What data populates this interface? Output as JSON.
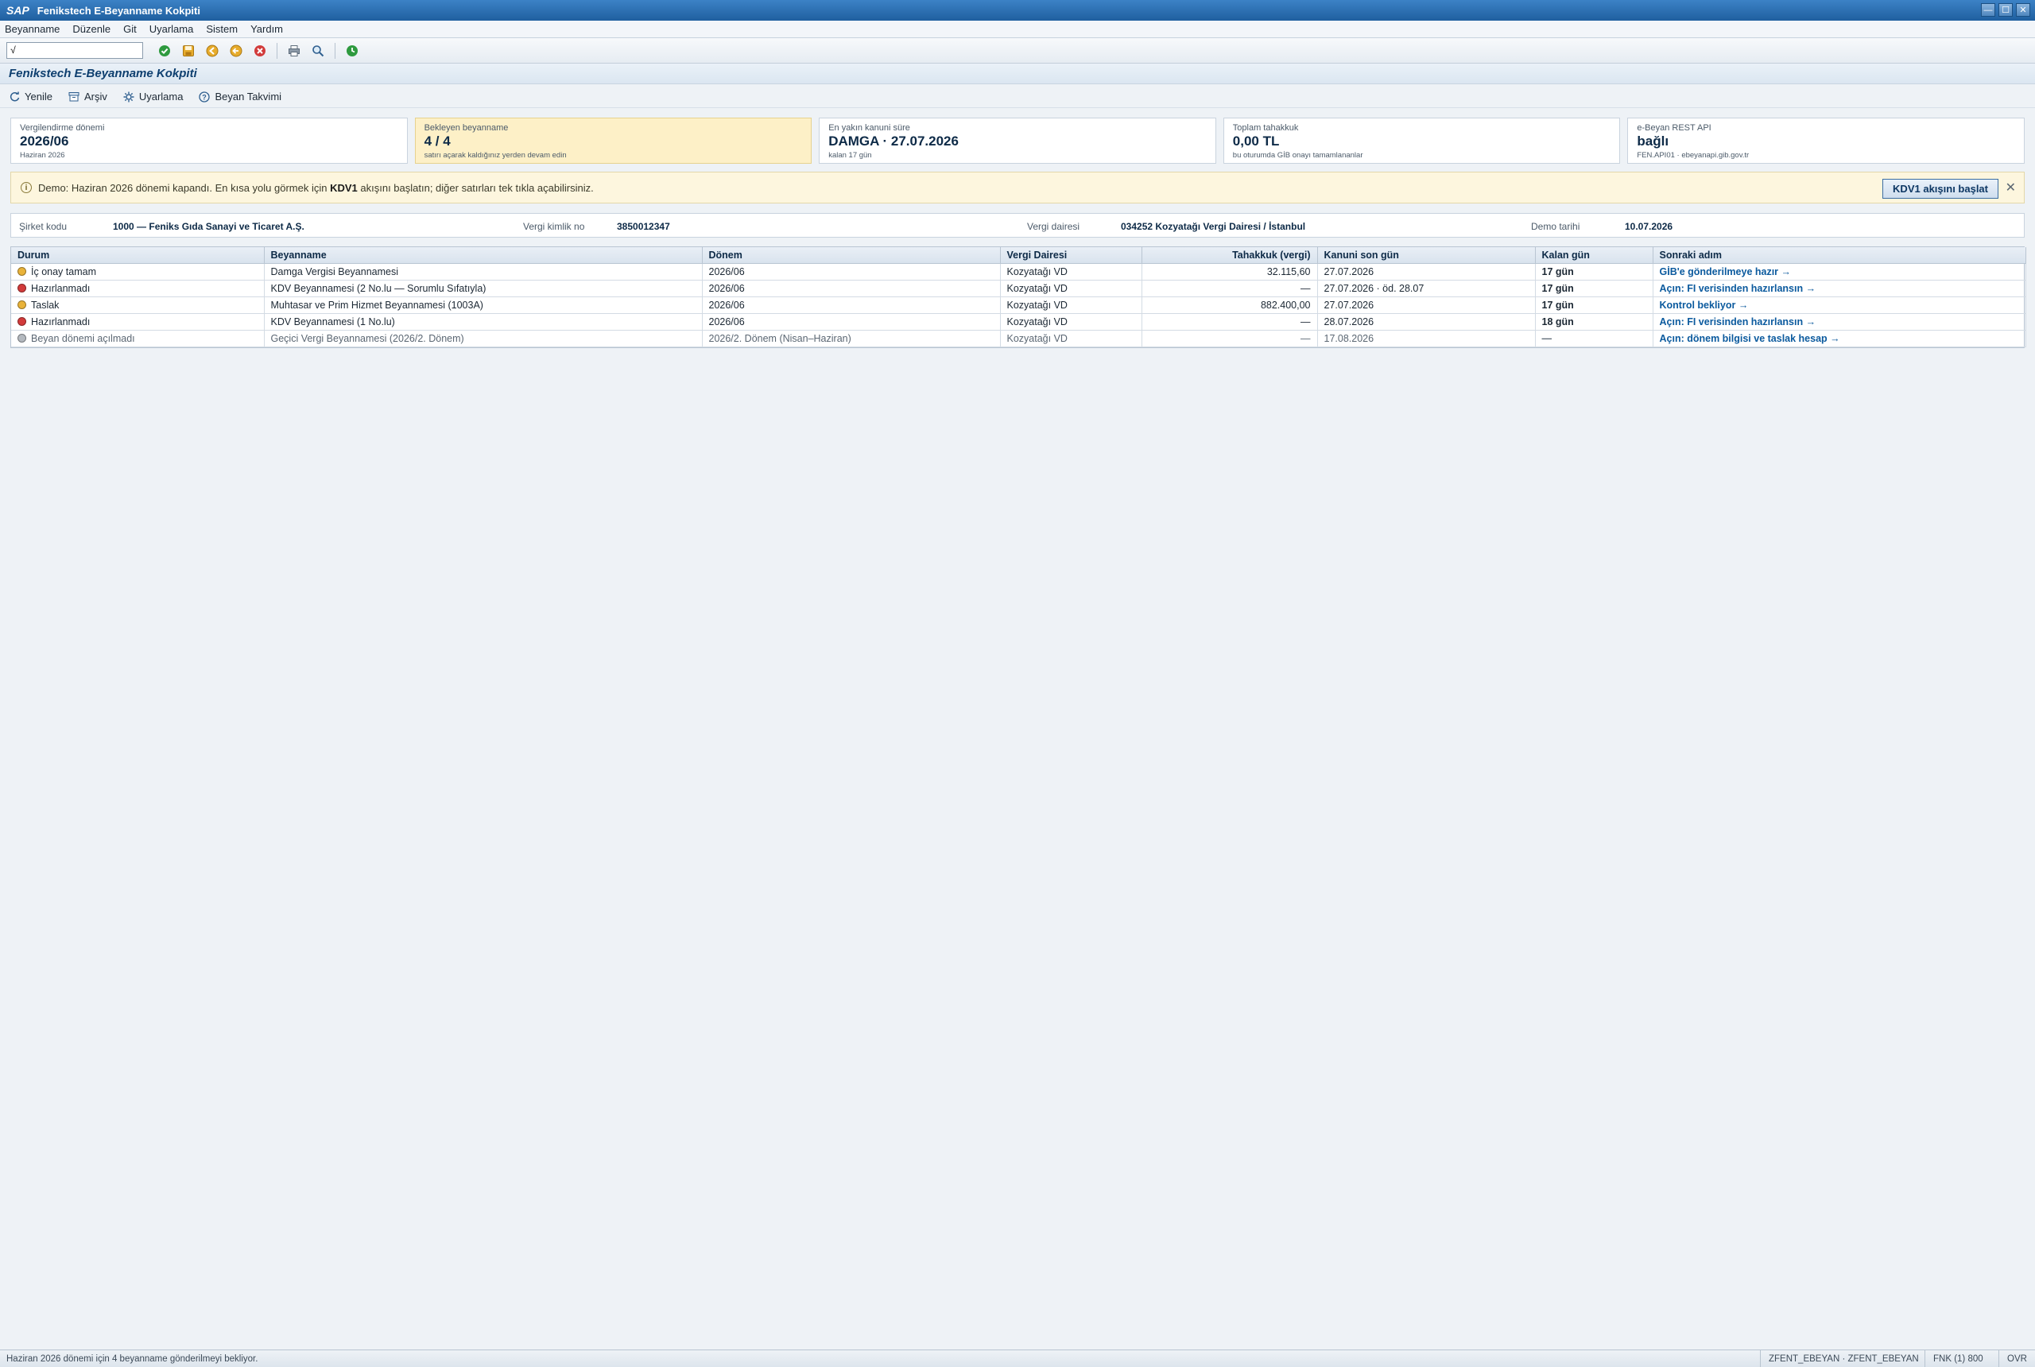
{
  "window": {
    "logo": "SAP",
    "title": "Fenikstech E-Beyanname Kokpiti"
  },
  "menu": [
    "Beyanname",
    "Düzenle",
    "Git",
    "Uyarlama",
    "Sistem",
    "Yardım"
  ],
  "toolbar": {
    "command_value": "√"
  },
  "header": {
    "title": "Fenikstech E-Beyanname Kokpiti"
  },
  "app_toolbar": {
    "refresh": "Yenile",
    "archive": "Arşiv",
    "settings": "Uyarlama",
    "calendar": "Beyan Takvimi"
  },
  "kpis": [
    {
      "label": "Vergilendirme dönemi",
      "value": "2026/06",
      "sub": "Haziran 2026"
    },
    {
      "label": "Bekleyen beyanname",
      "value": "4 / 4",
      "sub": "satırı açarak kaldığınız yerden devam edin"
    },
    {
      "label": "En yakın kanuni süre",
      "value": "DAMGA · 27.07.2026",
      "sub": "kalan 17 gün"
    },
    {
      "label": "Toplam tahakkuk",
      "value": "0,00 TL",
      "sub": "bu oturumda GİB onayı tamamlananlar"
    },
    {
      "label": "e-Beyan REST API",
      "value": "bağlı",
      "sub": "FEN.API01 · ebeyanapi.gib.gov.tr"
    }
  ],
  "banner": {
    "text_before": "Demo: Haziran 2026 dönemi kapandı. En kısa yolu görmek için ",
    "text_bold": "KDV1",
    "text_after": " akışını başlatın; diğer satırları tek tıkla açabilirsiniz.",
    "button": "KDV1 akışını başlat",
    "close": "✕"
  },
  "company": {
    "code_label": "Şirket kodu",
    "code_value": "1000 — Feniks Gıda Sanayi ve Ticaret A.Ş.",
    "tax_id_label": "Vergi kimlik no",
    "tax_id_value": "3850012347",
    "office_label": "Vergi dairesi",
    "office_value": "034252 Kozyatağı Vergi Dairesi / İstanbul",
    "demo_label": "Demo tarihi",
    "demo_value": "10.07.2026"
  },
  "table": {
    "columns": [
      "Durum",
      "Beyanname",
      "Dönem",
      "Vergi Dairesi",
      "Tahakkuk (vergi)",
      "Kanuni son gün",
      "Kalan gün",
      "Sonraki adım"
    ],
    "rows": [
      {
        "status": "İç onay tamam",
        "color": "#e9b33a",
        "name": "Damga Vergisi Beyannamesi",
        "period": "2026/06",
        "office": "Kozyatağı VD",
        "amount": "32.115,60",
        "deadline": "27.07.2026",
        "days": "17 gün",
        "next": "GİB'e gönderilmeye hazır →"
      },
      {
        "status": "Hazırlanmadı",
        "color": "#d23b3b",
        "name": "KDV Beyannamesi (2 No.lu — Sorumlu Sıfatıyla)",
        "period": "2026/06",
        "office": "Kozyatağı VD",
        "amount": "—",
        "deadline": "27.07.2026 · öd. 28.07",
        "days": "17 gün",
        "next": "Açın: FI verisinden hazırlansın →"
      },
      {
        "status": "Taslak",
        "color": "#e9b33a",
        "name": "Muhtasar ve Prim Hizmet Beyannamesi (1003A)",
        "period": "2026/06",
        "office": "Kozyatağı VD",
        "amount": "882.400,00",
        "deadline": "27.07.2026",
        "days": "17 gün",
        "next": "Kontrol bekliyor →"
      },
      {
        "status": "Hazırlanmadı",
        "color": "#d23b3b",
        "name": "KDV Beyannamesi (1 No.lu)",
        "period": "2026/06",
        "office": "Kozyatağı VD",
        "amount": "—",
        "deadline": "28.07.2026",
        "days": "18 gün",
        "next": "Açın: FI verisinden hazırlansın →"
      },
      {
        "status": "Beyan dönemi açılmadı",
        "color": "#b4b9bf",
        "name": "Geçici Vergi Beyannamesi (2026/2. Dönem)",
        "period": "2026/2. Dönem (Nisan–Haziran)",
        "office": "Kozyatağı VD",
        "amount": "—",
        "deadline": "17.08.2026",
        "days": "—",
        "next": "Açın: dönem bilgisi ve taslak hesap →",
        "muted": true
      }
    ]
  },
  "statusbar": {
    "message": "Haziran 2026 dönemi için 4 beyanname gönderilmeyi bekliyor.",
    "transaction": "ZFENT_EBEYAN · ZFENT_EBEYAN",
    "system": "FNK (1) 800",
    "mode": "OVR"
  }
}
